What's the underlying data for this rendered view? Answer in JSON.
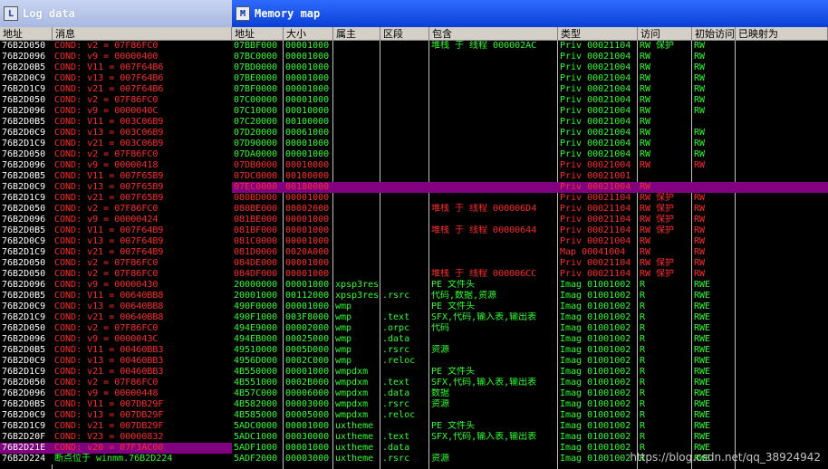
{
  "log": {
    "title": "Log data",
    "icon": "log-window-icon",
    "columns": [
      "地址",
      "消息"
    ],
    "rows": [
      {
        "a": "76B2D050",
        "m": "COND: v2 = 07F86FC0"
      },
      {
        "a": "76B2D096",
        "m": "COND: v9 = 00000400"
      },
      {
        "a": "76B2D0B5",
        "m": "COND: V11 = 007F64B6"
      },
      {
        "a": "76B2D0C9",
        "m": "COND: v13 = 007F64B6"
      },
      {
        "a": "76B2D1C9",
        "m": "COND: v21 = 007F64B6"
      },
      {
        "a": "76B2D050",
        "m": "COND: v2 = 07F86FC0"
      },
      {
        "a": "76B2D096",
        "m": "COND: v9 = 0000040C"
      },
      {
        "a": "76B2D0B5",
        "m": "COND: V11 = 003C06B9"
      },
      {
        "a": "76B2D0C9",
        "m": "COND: v13 = 003C06B9"
      },
      {
        "a": "76B2D1C9",
        "m": "COND: v21 = 003C06B9"
      },
      {
        "a": "76B2D050",
        "m": "COND: v2 = 07F86FC0"
      },
      {
        "a": "76B2D096",
        "m": "COND: v9 = 00000418"
      },
      {
        "a": "76B2D0B5",
        "m": "COND: V11 = 007F65B9"
      },
      {
        "a": "76B2D0C9",
        "m": "COND: v13 = 007F65B9"
      },
      {
        "a": "76B2D1C9",
        "m": "COND: v21 = 007F65B9"
      },
      {
        "a": "76B2D050",
        "m": "COND: v2 = 07F86FC0"
      },
      {
        "a": "76B2D096",
        "m": "COND: v9 = 00000424"
      },
      {
        "a": "76B2D0B5",
        "m": "COND: V11 = 007F64B9"
      },
      {
        "a": "76B2D0C9",
        "m": "COND: v13 = 007F64B9"
      },
      {
        "a": "76B2D1C9",
        "m": "COND: v21 = 007F64B9"
      },
      {
        "a": "76B2D050",
        "m": "COND: v2 = 07F86FC0"
      },
      {
        "a": "76B2D050",
        "m": "COND: v2 = 07F86FC0"
      },
      {
        "a": "76B2D096",
        "m": "COND: v9 = 00000430"
      },
      {
        "a": "76B2D0B5",
        "m": "COND: V11 = 00640BB8"
      },
      {
        "a": "76B2D0C9",
        "m": "COND: v13 = 00640BB8"
      },
      {
        "a": "76B2D1C9",
        "m": "COND: v21 = 00640BB8"
      },
      {
        "a": "76B2D050",
        "m": "COND: v2 = 07F86FC0"
      },
      {
        "a": "76B2D096",
        "m": "COND: v9 = 0000043C"
      },
      {
        "a": "76B2D0B5",
        "m": "COND: V11 = 00460BB3"
      },
      {
        "a": "76B2D0C9",
        "m": "COND: v13 = 00460BB3"
      },
      {
        "a": "76B2D1C9",
        "m": "COND: v21 = 00460BB3"
      },
      {
        "a": "76B2D050",
        "m": "COND: v2 = 07F86FC0"
      },
      {
        "a": "76B2D096",
        "m": "COND: v9 = 00000448"
      },
      {
        "a": "76B2D0B5",
        "m": "COND: V11 = 007DB29F"
      },
      {
        "a": "76B2D0C9",
        "m": "COND: v13 = 007DB29F"
      },
      {
        "a": "76B2D1C9",
        "m": "COND: v21 = 007DB29F"
      },
      {
        "a": "76B2D20F",
        "m": "COND: V23 = 00000832"
      },
      {
        "a": "76B2D21E",
        "m": "COND: v20 = 07F3AC00",
        "sel": true
      },
      {
        "a": "76B2D224",
        "m": "断点位于 winmm.76B2D224",
        "green": true
      }
    ]
  },
  "mem": {
    "title": "Memory map",
    "icon": "memory-map-icon",
    "columns": [
      "地址",
      "大小",
      "属主",
      "区段",
      "包含",
      "类型",
      "访问",
      "初始访问",
      "已映射为"
    ],
    "rows": [
      {
        "a": "07BBF000",
        "s": "00001000",
        "o": "",
        "sec": "",
        "c": "堆栈 于  线程  000002AC",
        "t": "Priv 00021104",
        "acc": "RW  保护",
        "init": "RW",
        "c1": "g",
        "c2": "g"
      },
      {
        "a": "07BC0000",
        "s": "00001000",
        "o": "",
        "sec": "",
        "c": "",
        "t": "Priv 00021004",
        "acc": "RW",
        "init": "RW",
        "c1": "g",
        "c2": "g"
      },
      {
        "a": "07BD0000",
        "s": "00001000",
        "o": "",
        "sec": "",
        "c": "",
        "t": "Priv 00021004",
        "acc": "RW",
        "init": "RW",
        "c1": "g",
        "c2": "g"
      },
      {
        "a": "07BE0000",
        "s": "00001000",
        "o": "",
        "sec": "",
        "c": "",
        "t": "Priv 00021004",
        "acc": "RW",
        "init": "RW",
        "c1": "g",
        "c2": "g"
      },
      {
        "a": "07BF0000",
        "s": "00001000",
        "o": "",
        "sec": "",
        "c": "",
        "t": "Priv 00021004",
        "acc": "RW",
        "init": "RW",
        "c1": "g",
        "c2": "g"
      },
      {
        "a": "07C00000",
        "s": "00001000",
        "o": "",
        "sec": "",
        "c": "",
        "t": "Priv 00021004",
        "acc": "RW",
        "init": "RW",
        "c1": "g",
        "c2": "g"
      },
      {
        "a": "07C10000",
        "s": "00010000",
        "o": "",
        "sec": "",
        "c": "",
        "t": "Priv 00021004",
        "acc": "RW",
        "init": "RW",
        "c1": "g",
        "c2": "g"
      },
      {
        "a": "07C20000",
        "s": "00100000",
        "o": "",
        "sec": "",
        "c": "",
        "t": "Priv 00021004",
        "acc": "RW",
        "init": "",
        "c1": "g",
        "c2": "g"
      },
      {
        "a": "07D20000",
        "s": "00061000",
        "o": "",
        "sec": "",
        "c": "",
        "t": "Priv 00021004",
        "acc": "RW",
        "init": "RW",
        "c1": "g",
        "c2": "g"
      },
      {
        "a": "07D90000",
        "s": "00001000",
        "o": "",
        "sec": "",
        "c": "",
        "t": "Priv 00021004",
        "acc": "RW",
        "init": "RW",
        "c1": "g",
        "c2": "g"
      },
      {
        "a": "07DA0000",
        "s": "00001000",
        "o": "",
        "sec": "",
        "c": "",
        "t": "Priv 00021004",
        "acc": "RW",
        "init": "RW",
        "c1": "g",
        "c2": "g"
      },
      {
        "a": "07DB0000",
        "s": "00010000",
        "o": "",
        "sec": "",
        "c": "",
        "t": "Priv 00021004",
        "acc": "RW",
        "init": "RW",
        "c1": "r",
        "c2": "r"
      },
      {
        "a": "07DC0000",
        "s": "00100000",
        "o": "",
        "sec": "",
        "c": "",
        "t": "Priv 00021001",
        "acc": "",
        "init": "",
        "c1": "r",
        "c2": "r"
      },
      {
        "a": "07EC0000",
        "s": "00180000",
        "o": "",
        "sec": "",
        "c": "",
        "t": "Priv 00021004",
        "acc": "RW",
        "init": "",
        "c1": "r",
        "c2": "r",
        "sel": true
      },
      {
        "a": "080BD000",
        "s": "00001000",
        "o": "",
        "sec": "",
        "c": "",
        "t": "Priv 00021104",
        "acc": "RW  保护",
        "init": "RW",
        "c1": "r",
        "c2": "r"
      },
      {
        "a": "080BE000",
        "s": "00002000",
        "o": "",
        "sec": "",
        "c": "堆栈 于  线程  000006D4",
        "t": "Priv 00021104",
        "acc": "RW  保护",
        "init": "RW",
        "c1": "r",
        "c2": "r"
      },
      {
        "a": "081BE000",
        "s": "00001000",
        "o": "",
        "sec": "",
        "c": "",
        "t": "Priv 00021104",
        "acc": "RW  保护",
        "init": "RW",
        "c1": "r",
        "c2": "r"
      },
      {
        "a": "081BF000",
        "s": "00001000",
        "o": "",
        "sec": "",
        "c": "堆栈 于  线程  00000644",
        "t": "Priv 00021104",
        "acc": "RW  保护",
        "init": "RW",
        "c1": "r",
        "c2": "r"
      },
      {
        "a": "081C0000",
        "s": "00001000",
        "o": "",
        "sec": "",
        "c": "",
        "t": "Priv 00021004",
        "acc": "RW",
        "init": "RW",
        "c1": "r",
        "c2": "r"
      },
      {
        "a": "081D0000",
        "s": "0020A000",
        "o": "",
        "sec": "",
        "c": "",
        "t": "Map  00041004",
        "acc": "RW",
        "init": "RW",
        "c1": "r",
        "c2": "r"
      },
      {
        "a": "084DE000",
        "s": "00001000",
        "o": "",
        "sec": "",
        "c": "",
        "t": "Priv 00021104",
        "acc": "RW  保护",
        "init": "RW",
        "c1": "r",
        "c2": "r"
      },
      {
        "a": "084DF000",
        "s": "00001000",
        "o": "",
        "sec": "",
        "c": "堆栈 于  线程  000006CC",
        "t": "Priv 00021104",
        "acc": "RW  保护",
        "init": "RW",
        "c1": "r",
        "c2": "r"
      },
      {
        "a": "20000000",
        "s": "00001000",
        "o": "xpsp3res",
        "sec": "",
        "c": "PE 文件头",
        "t": "Imag 01001002",
        "acc": "R",
        "init": "RWE",
        "c1": "g",
        "c2": "g"
      },
      {
        "a": "20001000",
        "s": "00112000",
        "o": "xpsp3res",
        "sec": ".rsrc",
        "c": "代码,数据,资源",
        "t": "Imag 01001002",
        "acc": "R",
        "init": "RWE",
        "c1": "g",
        "c2": "g"
      },
      {
        "a": "490F0000",
        "s": "00001000",
        "o": "wmp",
        "sec": "",
        "c": "PE 文件头",
        "t": "Imag 01001002",
        "acc": "R",
        "init": "RWE",
        "c1": "g",
        "c2": "g"
      },
      {
        "a": "490F1000",
        "s": "003F8000",
        "o": "wmp",
        "sec": ".text",
        "c": "SFX,代码,输入表,输出表",
        "t": "Imag 01001002",
        "acc": "R",
        "init": "RWE",
        "c1": "g",
        "c2": "g"
      },
      {
        "a": "494E9000",
        "s": "00002000",
        "o": "wmp",
        "sec": ".orpc",
        "c": "代码",
        "t": "Imag 01001002",
        "acc": "R",
        "init": "RWE",
        "c1": "g",
        "c2": "g"
      },
      {
        "a": "494EB000",
        "s": "00025000",
        "o": "wmp",
        "sec": ".data",
        "c": "",
        "t": "Imag 01001002",
        "acc": "R",
        "init": "RWE",
        "c1": "g",
        "c2": "g"
      },
      {
        "a": "49510000",
        "s": "0005D000",
        "o": "wmp",
        "sec": ".rsrc",
        "c": "资源",
        "t": "Imag 01001002",
        "acc": "R",
        "init": "RWE",
        "c1": "g",
        "c2": "g"
      },
      {
        "a": "4956D000",
        "s": "0002C000",
        "o": "wmp",
        "sec": ".reloc",
        "c": "",
        "t": "Imag 01001002",
        "acc": "R",
        "init": "RWE",
        "c1": "g",
        "c2": "g"
      },
      {
        "a": "4B550000",
        "s": "00001000",
        "o": "wmpdxm",
        "sec": "",
        "c": "PE 文件头",
        "t": "Imag 01001002",
        "acc": "R",
        "init": "RWE",
        "c1": "g",
        "c2": "g"
      },
      {
        "a": "4B551000",
        "s": "0002B000",
        "o": "wmpdxm",
        "sec": ".text",
        "c": "SFX,代码,输入表,输出表",
        "t": "Imag 01001002",
        "acc": "R",
        "init": "RWE",
        "c1": "g",
        "c2": "g"
      },
      {
        "a": "4B57C000",
        "s": "00006000",
        "o": "wmpdxm",
        "sec": ".data",
        "c": "数据",
        "t": "Imag 01001002",
        "acc": "R",
        "init": "RWE",
        "c1": "g",
        "c2": "g"
      },
      {
        "a": "4B582000",
        "s": "00003000",
        "o": "wmpdxm",
        "sec": ".rsrc",
        "c": "资源",
        "t": "Imag 01001002",
        "acc": "R",
        "init": "RWE",
        "c1": "g",
        "c2": "g"
      },
      {
        "a": "4B585000",
        "s": "00005000",
        "o": "wmpdxm",
        "sec": ".reloc",
        "c": "",
        "t": "Imag 01001002",
        "acc": "R",
        "init": "RWE",
        "c1": "g",
        "c2": "g"
      },
      {
        "a": "5ADC0000",
        "s": "00001000",
        "o": "uxtheme",
        "sec": "",
        "c": "PE 文件头",
        "t": "Imag 01001002",
        "acc": "R",
        "init": "RWE",
        "c1": "g",
        "c2": "g"
      },
      {
        "a": "5ADC1000",
        "s": "00030000",
        "o": "uxtheme",
        "sec": ".text",
        "c": "SFX,代码,输入表,输出表",
        "t": "Imag 01001002",
        "acc": "R",
        "init": "RWE",
        "c1": "g",
        "c2": "g"
      },
      {
        "a": "5ADF1000",
        "s": "00001000",
        "o": "uxtheme",
        "sec": ".data",
        "c": "",
        "t": "Imag 01001002",
        "acc": "R",
        "init": "RWE",
        "c1": "g",
        "c2": "g"
      },
      {
        "a": "5ADF2000",
        "s": "00003000",
        "o": "uxtheme",
        "sec": ".rsrc",
        "c": "资源",
        "t": "Imag 01001002",
        "acc": "R",
        "init": "RWE",
        "c1": "g",
        "c2": "g"
      }
    ]
  },
  "watermark": "https://blog.csdn.net/qq_38924942",
  "colors": {
    "red": "#ff2a2a",
    "green": "#2cff2c",
    "selected": "#800080",
    "gray": "#c0c0c0"
  }
}
